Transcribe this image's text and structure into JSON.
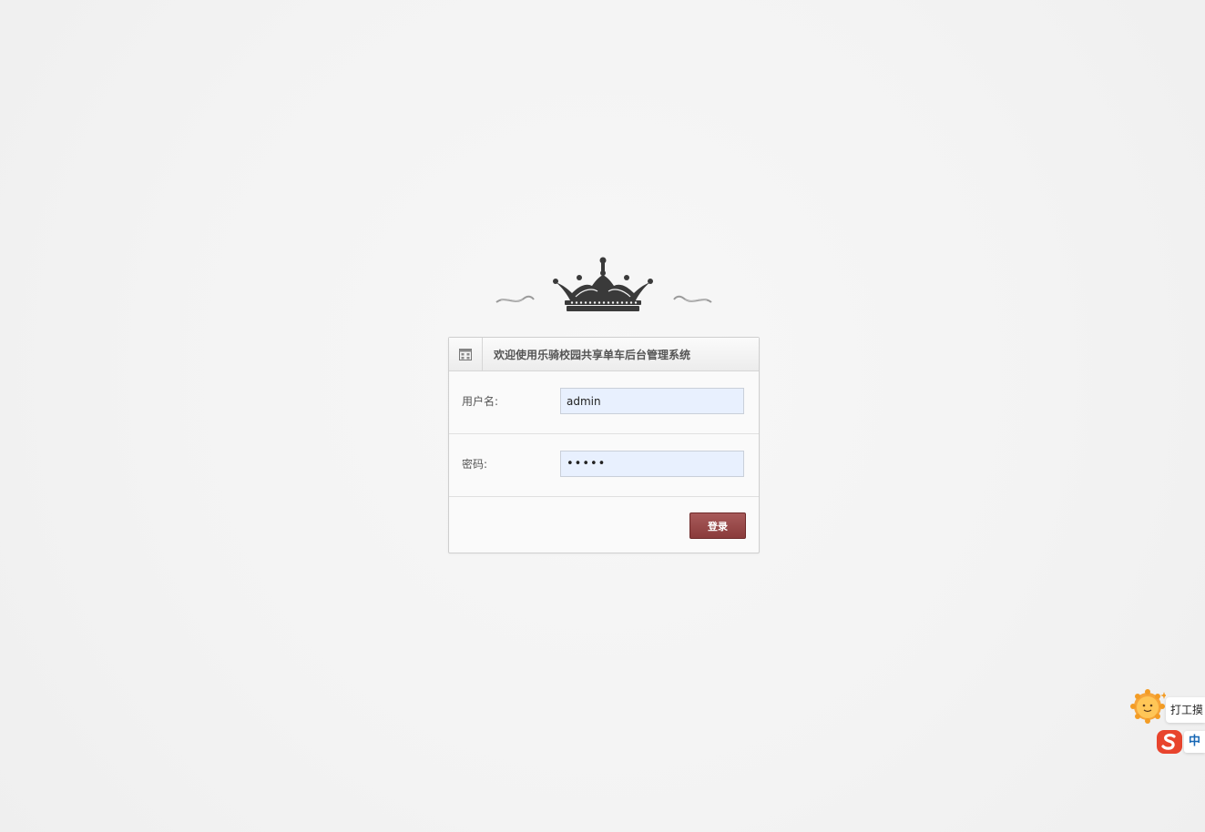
{
  "header": {
    "title": "欢迎使用乐骑校园共享单车后台管理系统",
    "icon": "building-icon"
  },
  "form": {
    "username": {
      "label": "用户名:",
      "value": "admin"
    },
    "password": {
      "label": "密码:",
      "value": "•••••"
    },
    "submit_label": "登录"
  },
  "decoration": {
    "icon": "crown-icon"
  },
  "ime": {
    "tip_text": "打工摸",
    "lang": "中",
    "mascot_icon": "sun-mascot-icon",
    "logo_icon": "sogou-logo-icon"
  },
  "colors": {
    "button": "#8a3b3b",
    "input_bg": "#e8f0fe",
    "crown": "#3a3a3a"
  }
}
